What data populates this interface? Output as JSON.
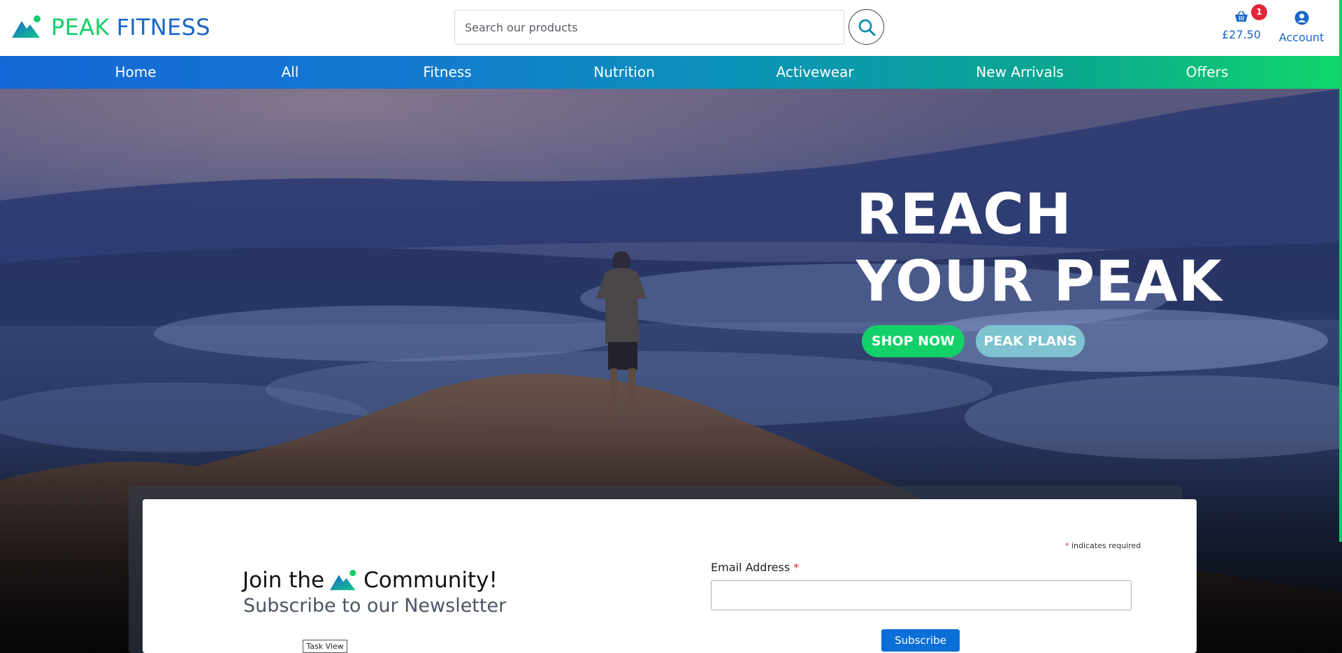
{
  "brand": {
    "word1": "PEAK",
    "word2": "FITNESS",
    "primary_color": "#1b67c9",
    "accent_color": "#15cf6a"
  },
  "search": {
    "placeholder": "Search our products"
  },
  "basket": {
    "count": "1",
    "total": "£27.50"
  },
  "account": {
    "label": "Account"
  },
  "nav": {
    "items": [
      "Home",
      "All",
      "Fitness",
      "Nutrition",
      "Activewear",
      "New Arrivals",
      "Offers"
    ]
  },
  "hero": {
    "title_line1": "REACH",
    "title_line2": "YOUR PEAK",
    "shop_label": "SHOP NOW",
    "plans_label": "PEAK PLANS"
  },
  "newsletter": {
    "join_before": "Join the",
    "join_after": "Community!",
    "subtitle": "Subscribe to our Newsletter",
    "required_star": "*",
    "required_note": "indicates required",
    "email_label": "Email Address",
    "email_star": "*",
    "subscribe_label": "Subscribe"
  },
  "tooltip": {
    "label": "Task View"
  },
  "icons": {
    "search": "search-icon",
    "basket": "basket-icon",
    "account": "user-circle-icon",
    "logo": "mountain-logo-icon"
  }
}
